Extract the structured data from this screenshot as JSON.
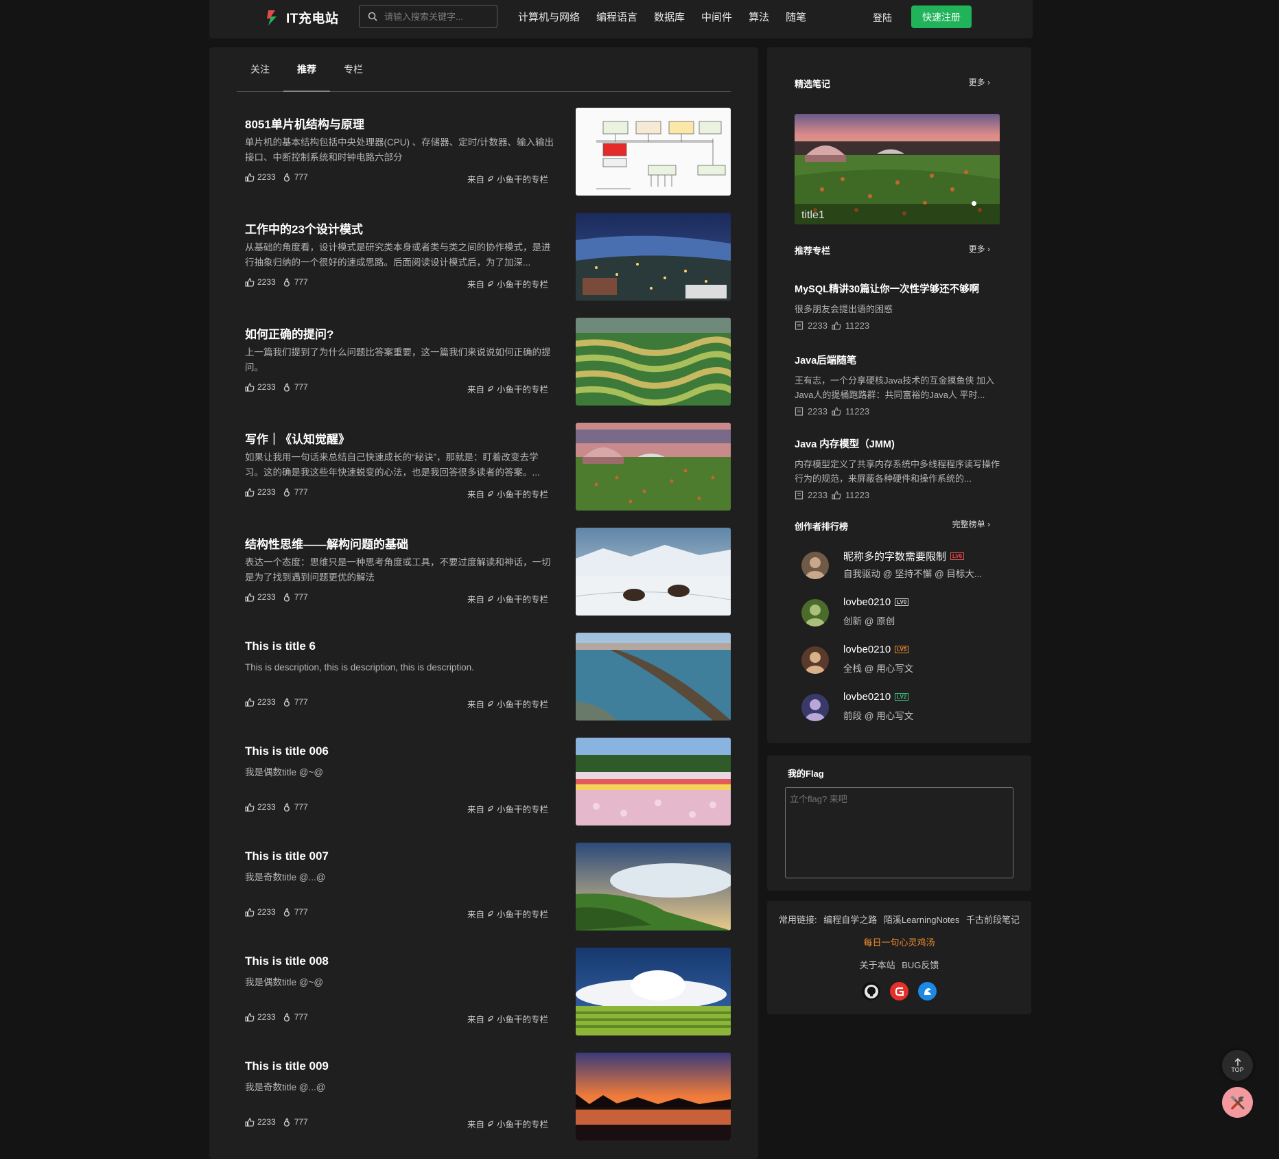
{
  "header": {
    "logo_text": "IT充电站",
    "search_placeholder": "请输入搜索关键字...",
    "nav": [
      "计算机与网络",
      "编程语言",
      "数据库",
      "中间件",
      "算法",
      "随笔"
    ],
    "login": "登陆",
    "register": "快速注册"
  },
  "tabs": [
    "关注",
    "推荐",
    "专栏"
  ],
  "articles": [
    {
      "title": "8051单片机结构与原理",
      "desc": "单片机的基本结构包括中央处理器(CPU) 、存储器、定时/计数器、输入输出接口、中断控制系统和时钟电路六部分",
      "likes": "2233",
      "hot": "777",
      "from_label": "来自",
      "from": "小鱼干的专栏"
    },
    {
      "title": "工作中的23个设计模式",
      "desc": "从基础的角度看，设计模式是研究类本身或者类与类之间的协作模式，是进行抽象归纳的一个很好的速成思路。后面阅读设计模式后，为了加深...",
      "likes": "2233",
      "hot": "777",
      "from_label": "来自",
      "from": "小鱼干的专栏"
    },
    {
      "title": "如何正确的提问?",
      "desc": "上一篇我们提到了为什么问题比答案重要，这一篇我们来说说如何正确的提问。",
      "likes": "2233",
      "hot": "777",
      "from_label": "来自",
      "from": "小鱼干的专栏"
    },
    {
      "title": "写作｜《认知觉醒》",
      "desc": "如果让我用一句话来总结自己快速成长的“秘诀”，那就是：盯着改变去学习。这的确是我这些年快速蜕变的心法，也是我回答很多读者的答案。...",
      "likes": "2233",
      "hot": "777",
      "from_label": "来自",
      "from": "小鱼干的专栏"
    },
    {
      "title": "结构性思维——解构问题的基础",
      "desc": "表达一个态度：思维只是一种思考角度或工具，不要过度解读和神话，一切是为了找到遇到问题更优的解法",
      "likes": "2233",
      "hot": "777",
      "from_label": "来自",
      "from": "小鱼干的专栏"
    },
    {
      "title": "This is title 6",
      "desc": "This is description, this is description, this is description.",
      "likes": "2233",
      "hot": "777",
      "from_label": "来自",
      "from": "小鱼干的专栏"
    },
    {
      "title": "This is title 006",
      "desc": "我是偶数title @~@",
      "likes": "2233",
      "hot": "777",
      "from_label": "来自",
      "from": "小鱼干的专栏"
    },
    {
      "title": "This is title 007",
      "desc": "我是奇数title @...@",
      "likes": "2233",
      "hot": "777",
      "from_label": "来自",
      "from": "小鱼干的专栏"
    },
    {
      "title": "This is title 008",
      "desc": "我是偶数title @~@",
      "likes": "2233",
      "hot": "777",
      "from_label": "来自",
      "from": "小鱼干的专栏"
    },
    {
      "title": "This is title 009",
      "desc": "我是奇数title @...@",
      "likes": "2233",
      "hot": "777",
      "from_label": "来自",
      "from": "小鱼干的专栏"
    }
  ],
  "sidebar": {
    "notes_title": "精选笔记",
    "more": "更多",
    "carousel_caption": "title1",
    "columns_title": "推荐专栏",
    "columns": [
      {
        "title": "MySQL精讲30篇让你一次性学够还不够啊",
        "desc": "很多朋友会提出语的困惑",
        "count": "2233",
        "likes": "11223"
      },
      {
        "title": "Java后端随笔",
        "desc": "王有志，一个分享硬核Java技术的互金摸鱼侠 加入Java人的提桶跑路群：共同富裕的Java人 平时...",
        "count": "2233",
        "likes": "11223"
      },
      {
        "title": "Java 内存模型（JMM)",
        "desc": "内存模型定义了共享内存系统中多线程程序读写操作行为的规范，来屏蔽各种硬件和操作系统的...",
        "count": "2233",
        "likes": "11223"
      }
    ],
    "ranking_title": "创作者排行榜",
    "ranking_more": "完整榜单",
    "ranking": [
      {
        "name": "昵称多的字数需要限制",
        "level": "LV6",
        "level_color": "#e5484d",
        "sub": "自我驱动 @ 坚持不懈 @ 目标大..."
      },
      {
        "name": "lovbe0210",
        "level": "LV0",
        "level_color": "#cfcfcf",
        "sub": "创新 @ 原创"
      },
      {
        "name": "lovbe0210",
        "level": "LV5",
        "level_color": "#f08c2c",
        "sub": "全栈 @ 用心写文"
      },
      {
        "name": "lovbe0210",
        "level": "LV2",
        "level_color": "#3fbf7a",
        "sub": "前段 @ 用心写文"
      }
    ],
    "flag_title": "我的Flag",
    "flag_placeholder": "立个flag? 来吧",
    "links_label": "常用链接:",
    "links": [
      "编程自学之路",
      "陌溪LearningNotes",
      "千古前段笔记"
    ],
    "daily": "每日一句心灵鸡汤",
    "about": "关于本站",
    "bug": "BUG反馈"
  },
  "float": {
    "top_label": "TOP"
  },
  "colors": {
    "accent": "#21b35a",
    "daily": "#f08c2c",
    "bg": "#141414",
    "panel": "#1f1f1f"
  }
}
